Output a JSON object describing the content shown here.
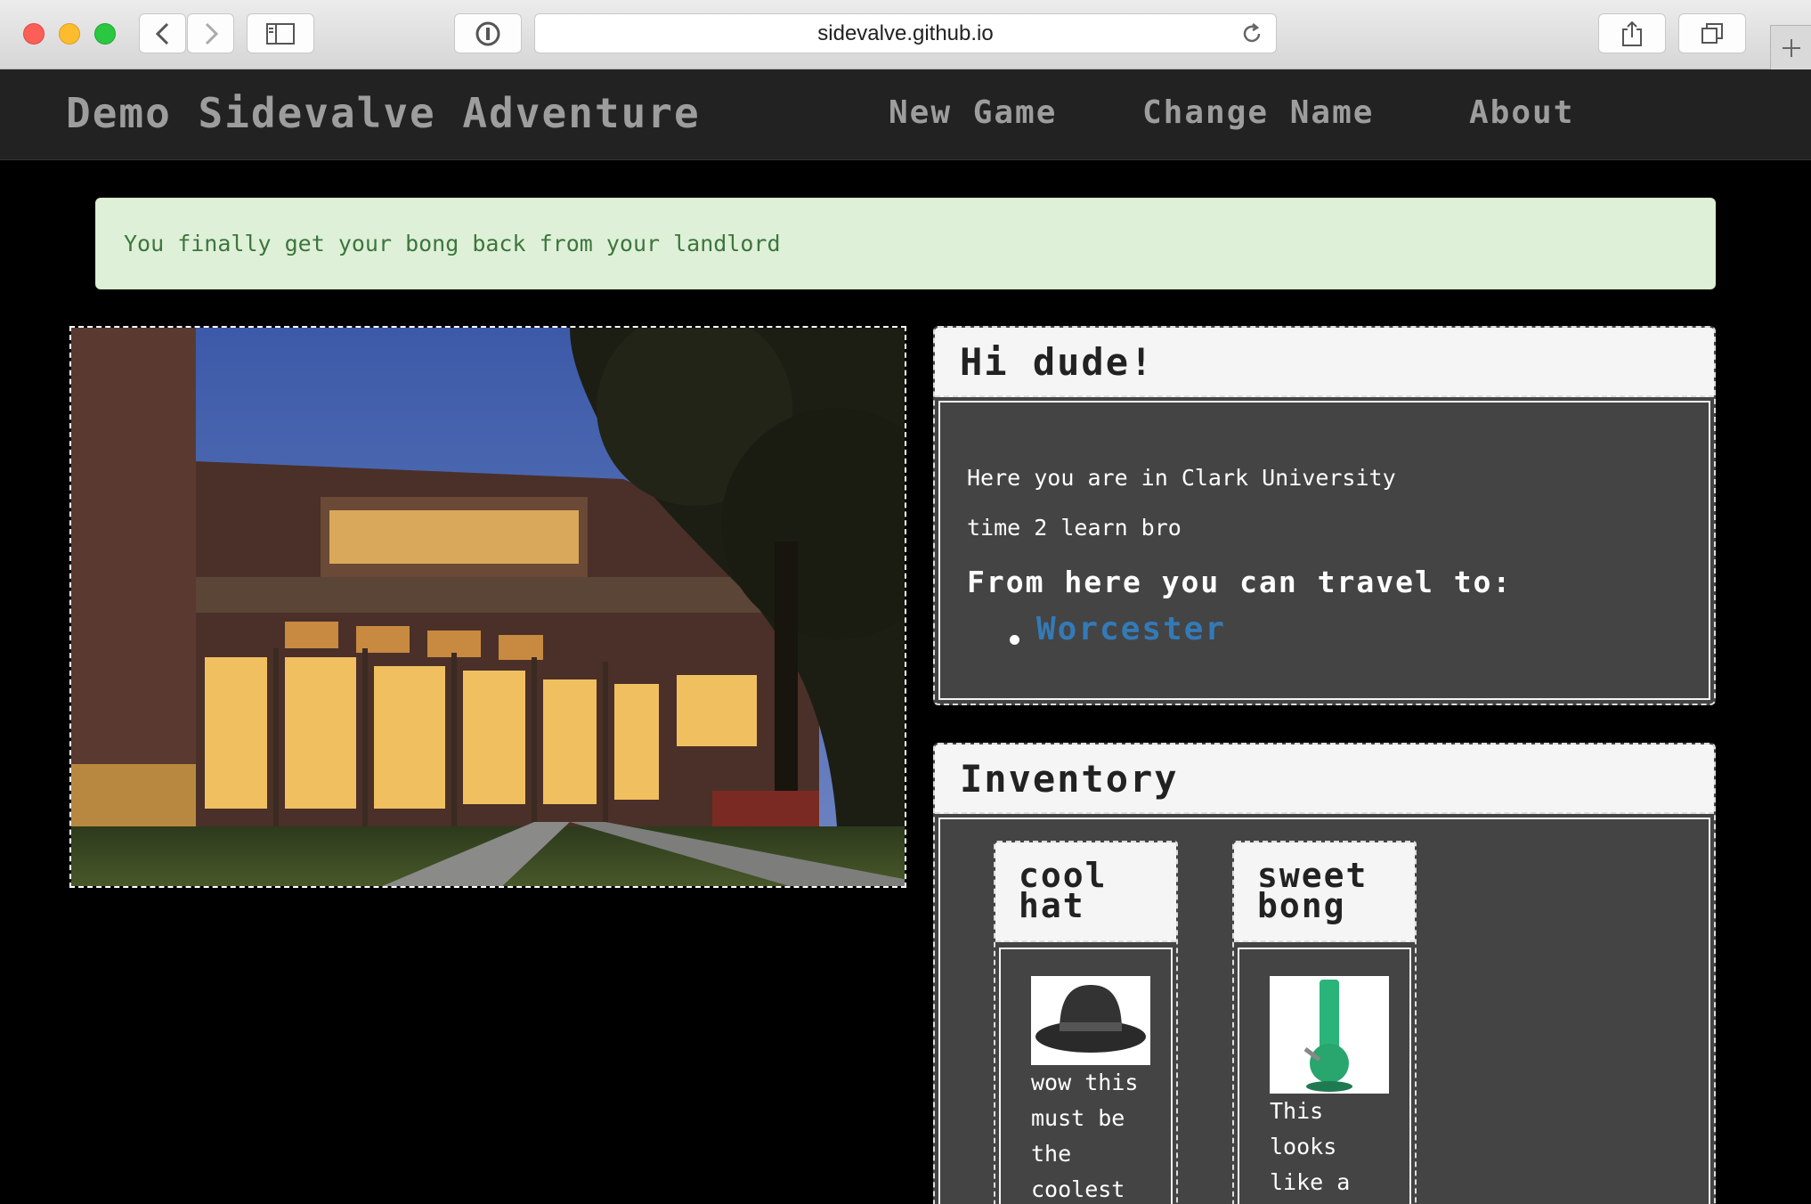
{
  "browser": {
    "url": "sidevalve.github.io"
  },
  "navbar": {
    "brand": "Demo Sidevalve Adventure",
    "items": [
      "New Game",
      "Change Name",
      "About"
    ]
  },
  "alert": {
    "message": "You finally get your bong back from your landlord"
  },
  "location_panel": {
    "greeting": "Hi dude!",
    "lines": [
      "Here you are in Clark University",
      "time 2 learn bro"
    ],
    "travel_heading": "From here you can travel to:",
    "destinations": [
      "Worcester"
    ]
  },
  "inventory": {
    "title": "Inventory",
    "items": [
      {
        "name_line1": "cool",
        "name_line2": "hat",
        "description": [
          "wow this",
          "must be",
          "the",
          "coolest"
        ]
      },
      {
        "name_line1": "sweet",
        "name_line2": "bong",
        "description": [
          "This",
          "looks",
          "like a"
        ]
      }
    ]
  },
  "colors": {
    "alert_bg": "#dff0d8",
    "alert_text": "#3c763d",
    "link": "#337ab7",
    "navbar_bg": "#222222"
  }
}
